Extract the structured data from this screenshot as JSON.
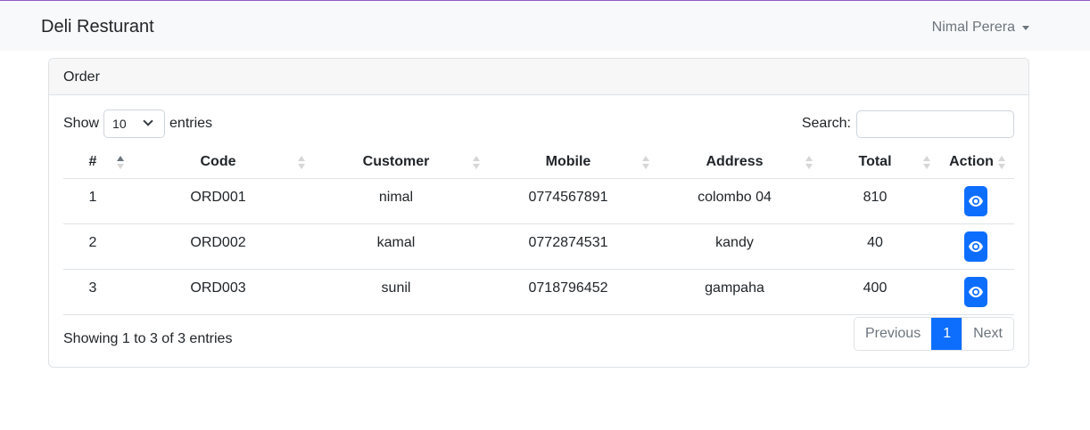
{
  "navbar": {
    "brand": "Deli Resturant",
    "user": "Nimal Perera"
  },
  "card": {
    "title": "Order"
  },
  "length": {
    "show_label": "Show",
    "selected": "10",
    "entries_label": "entries"
  },
  "search": {
    "label": "Search:",
    "value": "",
    "placeholder": ""
  },
  "table": {
    "columns": [
      "#",
      "Code",
      "Customer",
      "Mobile",
      "Address",
      "Total",
      "Action"
    ],
    "sorted_column": "#",
    "rows": [
      {
        "num": "1",
        "code": "ORD001",
        "customer": "nimal",
        "mobile": "0774567891",
        "address": "colombo 04",
        "total": "810"
      },
      {
        "num": "2",
        "code": "ORD002",
        "customer": "kamal",
        "mobile": "0772874531",
        "address": "kandy",
        "total": "40"
      },
      {
        "num": "3",
        "code": "ORD003",
        "customer": "sunil",
        "mobile": "0718796452",
        "address": "gampaha",
        "total": "400"
      }
    ],
    "action_icon": "eye-icon"
  },
  "footer": {
    "info": "Showing 1 to 3 of 3 entries",
    "previous": "Previous",
    "current_page": "1",
    "next": "Next"
  },
  "colors": {
    "accent": "#0d6efd",
    "navbar_bg": "#f8f9fa",
    "top_line": "#8e5cc4"
  }
}
